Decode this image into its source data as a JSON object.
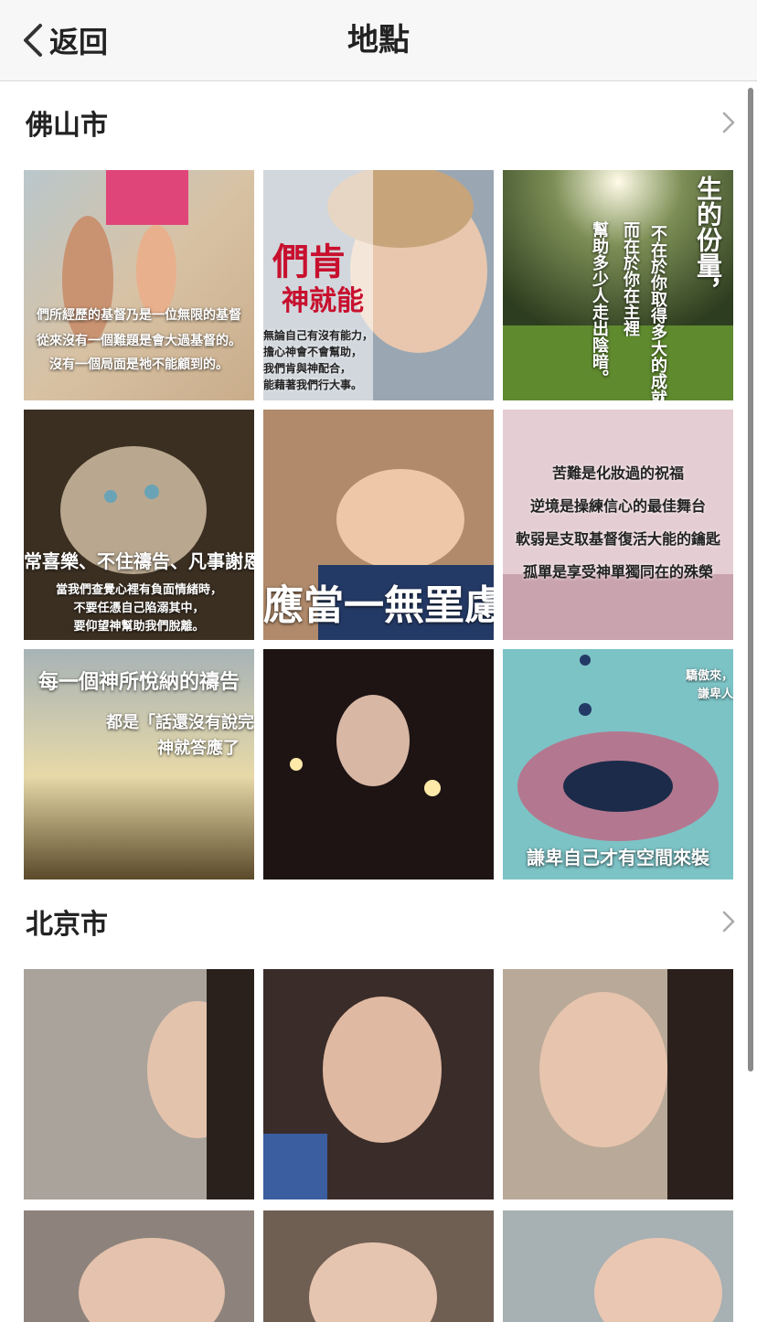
{
  "nav": {
    "back_label": "返回",
    "title": "地點"
  },
  "sections": [
    {
      "title": "佛山市",
      "tiles": [
        {
          "lines": [
            "們所經歷的基督乃是一位無限的基督",
            "從來沒有一個難題是會大過基督的。",
            "沒有一個局面是祂不能顧到的。"
          ]
        },
        {
          "lines": [
            "們肯",
            "神就能",
            "無論自己有沒有能力，",
            "擔心神會不會幫助，",
            "我們肯與神配合，",
            "能藉著我們行大事。"
          ]
        },
        {
          "lines": [
            "生的份量，",
            "不在於你取得多大的成就",
            "而在於你在主裡",
            "幫助多少人走出陰暗。"
          ]
        },
        {
          "lines": [
            "常喜樂、不住禱告、凡事謝恩",
            "當我們查覺心裡有負面情緒時，",
            "不要任憑自己陷溺其中，",
            "要仰望神幫助我們脫離。"
          ]
        },
        {
          "lines": [
            "應當一無罣慮"
          ]
        },
        {
          "lines": [
            "苦難是化妝過的祝福",
            "逆境是操練信心的最佳舞台",
            "軟弱是支取基督復活大能的鑰匙",
            "孤單是享受神單獨同在的殊榮"
          ]
        },
        {
          "lines": [
            "每一個神所悅納的禱告",
            "都是「話還沒有說完",
            "神就答應了"
          ]
        },
        {
          "lines": []
        },
        {
          "lines": [
            "驕傲來，",
            "謙卑人",
            "謙卑自己才有空間來裝"
          ]
        }
      ]
    },
    {
      "title": "北京市",
      "tiles": [
        {
          "lines": []
        },
        {
          "lines": []
        },
        {
          "lines": []
        },
        {
          "lines": []
        },
        {
          "lines": []
        },
        {
          "lines": []
        }
      ]
    }
  ],
  "colors": {
    "nav_bg": "#f7f7f7",
    "accent_red": "#c8102e",
    "text": "#222222"
  }
}
